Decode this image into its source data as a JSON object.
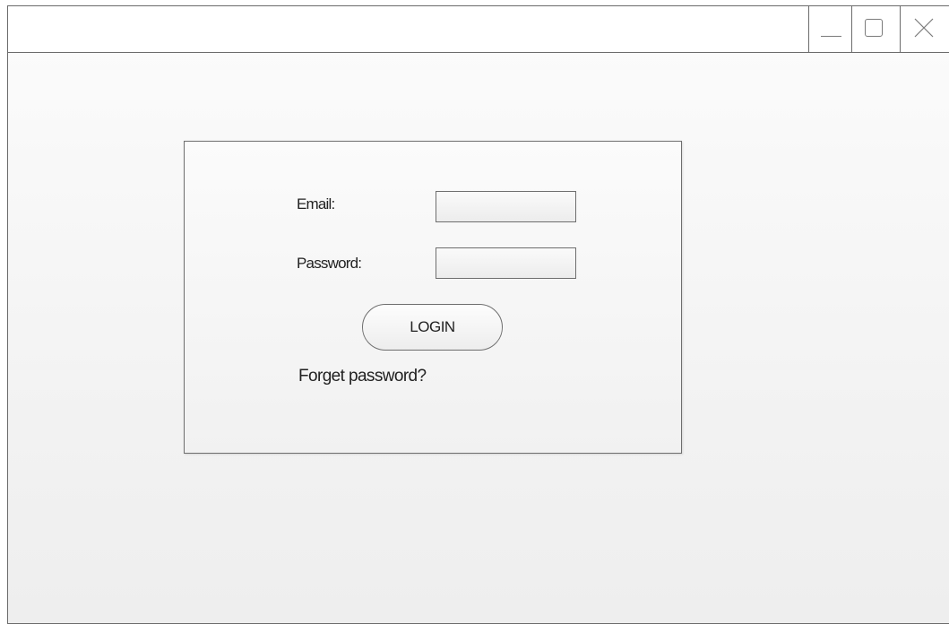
{
  "window": {
    "controls": {
      "minimize_icon": "minimize-icon",
      "maximize_icon": "maximize-icon",
      "close_icon": "close-icon"
    }
  },
  "login": {
    "email_label": "Email:",
    "email_value": "",
    "password_label": "Password:",
    "password_value": "",
    "login_button": "LOGIN",
    "forget_password": "Forget password?"
  },
  "colors": {
    "border": "#6e6e6e",
    "text": "#222222",
    "background": "#f3f3f3"
  }
}
